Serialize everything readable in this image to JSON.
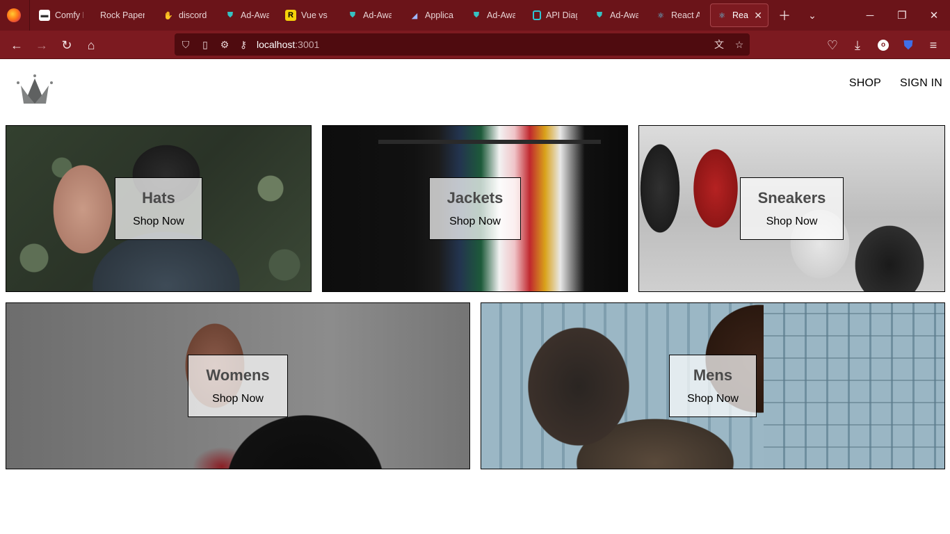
{
  "browser": {
    "tabs": [
      {
        "label": "Comfy H",
        "icon": "comfy-icon",
        "color": "#ffffff"
      },
      {
        "label": "Rock Paper S",
        "icon": "none",
        "color": "#ffffff"
      },
      {
        "label": "discord-",
        "icon": "discord-bot-icon",
        "color": "#f6a623"
      },
      {
        "label": "Ad-Awa",
        "icon": "shield-icon",
        "color": "#36c2c2"
      },
      {
        "label": "Vue vs R",
        "icon": "vue-vs-react-icon",
        "color": "#f5d20a"
      },
      {
        "label": "Ad-Awa",
        "icon": "shield-icon",
        "color": "#36c2c2"
      },
      {
        "label": "Applicat",
        "icon": "application-icon",
        "color": "#9fb7ff"
      },
      {
        "label": "Ad-Awa",
        "icon": "shield-icon",
        "color": "#36c2c2"
      },
      {
        "label": "API Diag",
        "icon": "api-diagram-icon",
        "color": "#2ec5d3"
      },
      {
        "label": "Ad-Awa",
        "icon": "shield-icon",
        "color": "#36c2c2"
      },
      {
        "label": "React Ap",
        "icon": "react-icon",
        "color": "#61dafb"
      },
      {
        "label": "React",
        "icon": "react-icon",
        "color": "#61dafb",
        "active": true
      }
    ],
    "url": {
      "host": "localhost",
      "port": ":3001"
    }
  },
  "site": {
    "nav": {
      "shop": "SHOP",
      "signin": "SIGN IN"
    },
    "categories": [
      {
        "title": "Hats",
        "subtitle": "Shop Now"
      },
      {
        "title": "Jackets",
        "subtitle": "Shop Now"
      },
      {
        "title": "Sneakers",
        "subtitle": "Shop Now"
      },
      {
        "title": "Womens",
        "subtitle": "Shop Now"
      },
      {
        "title": "Mens",
        "subtitle": "Shop Now"
      }
    ]
  },
  "colors": {
    "chrome_tabbar": "#6b1419",
    "chrome_navbar": "#7c1a20",
    "urlbar": "#4f0b0f"
  }
}
